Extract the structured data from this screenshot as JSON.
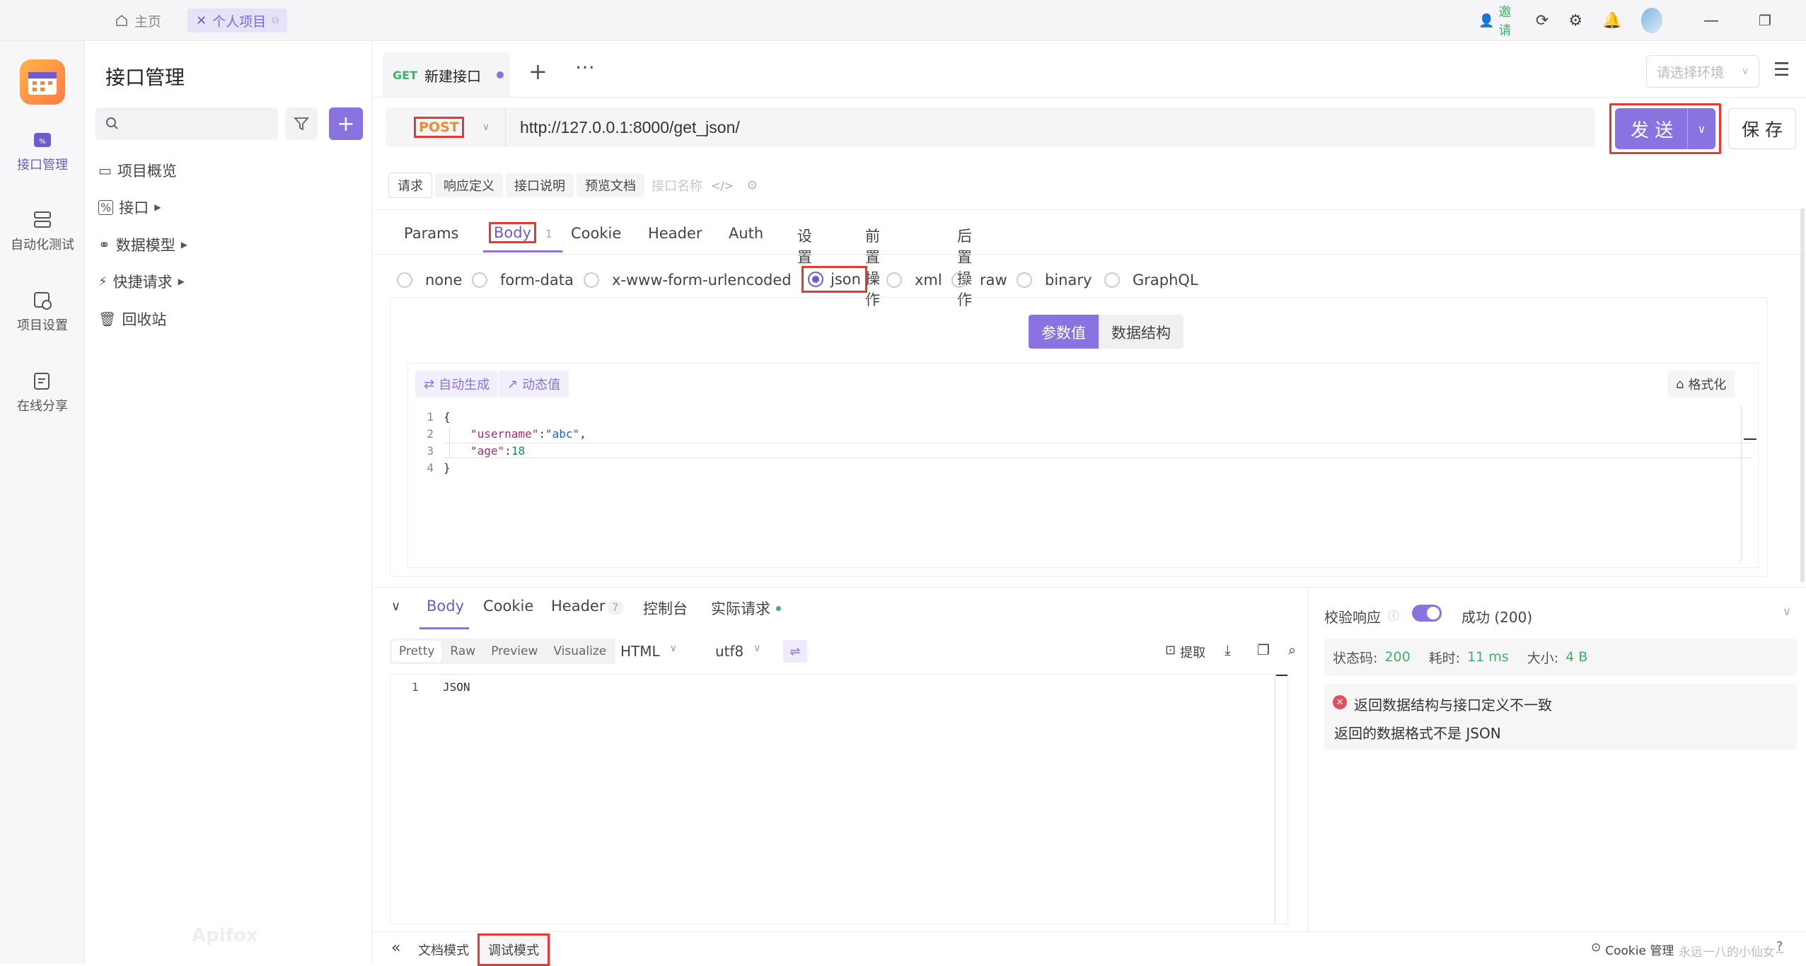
{
  "titlebar": {
    "home_tab": "主页",
    "project_tab": "个人项目",
    "invite": "邀请"
  },
  "sidebar": {
    "items": [
      {
        "label": "接口管理",
        "icon": "api-icon"
      },
      {
        "label": "自动化测试",
        "icon": "automation-icon"
      },
      {
        "label": "项目设置",
        "icon": "project-settings-icon"
      },
      {
        "label": "在线分享",
        "icon": "share-icon"
      }
    ]
  },
  "nav": {
    "title": "接口管理",
    "search_placeholder": "",
    "items": [
      {
        "label": "项目概览"
      },
      {
        "label": "接口"
      },
      {
        "label": "数据模型"
      },
      {
        "label": "快捷请求"
      },
      {
        "label": "回收站"
      }
    ],
    "watermark": "Apifox"
  },
  "request_tab": {
    "method_badge": "GET",
    "name": "新建接口",
    "env_placeholder": "请选择环境"
  },
  "url_bar": {
    "method": "POST",
    "url": "http://127.0.0.1:8000/get_json/",
    "send": "发 送",
    "save": "保 存"
  },
  "subtabs": {
    "items": [
      "请求",
      "响应定义",
      "接口说明",
      "预览文档"
    ],
    "name_placeholder": "接口名称"
  },
  "req_tabs": {
    "items": [
      "Params",
      "Body",
      "Cookie",
      "Header",
      "Auth",
      "设置",
      "前置操作",
      "后置操作"
    ],
    "body_count": "1"
  },
  "body_types": [
    "none",
    "form-data",
    "x-www-form-urlencoded",
    "json",
    "xml",
    "raw",
    "binary",
    "GraphQL"
  ],
  "toggle": {
    "values": "参数值",
    "schema": "数据结构"
  },
  "editor_tools": {
    "auto": "自动生成",
    "dynamic": "动态值",
    "format": "格式化"
  },
  "code": {
    "line_numbers": [
      "1",
      "2",
      "3",
      "4"
    ],
    "l1": "{",
    "l2_key": "\"username\"",
    "l2_colon": ":",
    "l2_val": "\"abc\"",
    "l2_comma": ",",
    "l3_key": "\"age\"",
    "l3_colon": ":",
    "l3_val": "18",
    "l4": "}"
  },
  "response": {
    "tabs": [
      "Body",
      "Cookie",
      "Header",
      "控制台",
      "实际请求"
    ],
    "header_count": "7",
    "view_modes": [
      "Pretty",
      "Raw",
      "Preview",
      "Visualize"
    ],
    "format": "HTML",
    "encoding": "utf8",
    "extract": "提取",
    "line1_no": "1",
    "line1": "JSON"
  },
  "validation": {
    "label": "校验响应",
    "result": "成功 (200)",
    "status_label": "状态码:",
    "status_value": "200",
    "time_label": "耗时:",
    "time_value": "11 ms",
    "size_label": "大小:",
    "size_value": "4 B",
    "error_title": "返回数据结构与接口定义不一致",
    "error_detail": "返回的数据格式不是 JSON"
  },
  "footer": {
    "doc_mode": "文档模式",
    "debug_mode": "调试模式",
    "cookie_mgr": "Cookie 管理",
    "credit": "永远一八的小仙女~"
  },
  "colors": {
    "accent": "#8a73e0",
    "highlight_red": "#e53935",
    "success": "#3bb36b"
  }
}
